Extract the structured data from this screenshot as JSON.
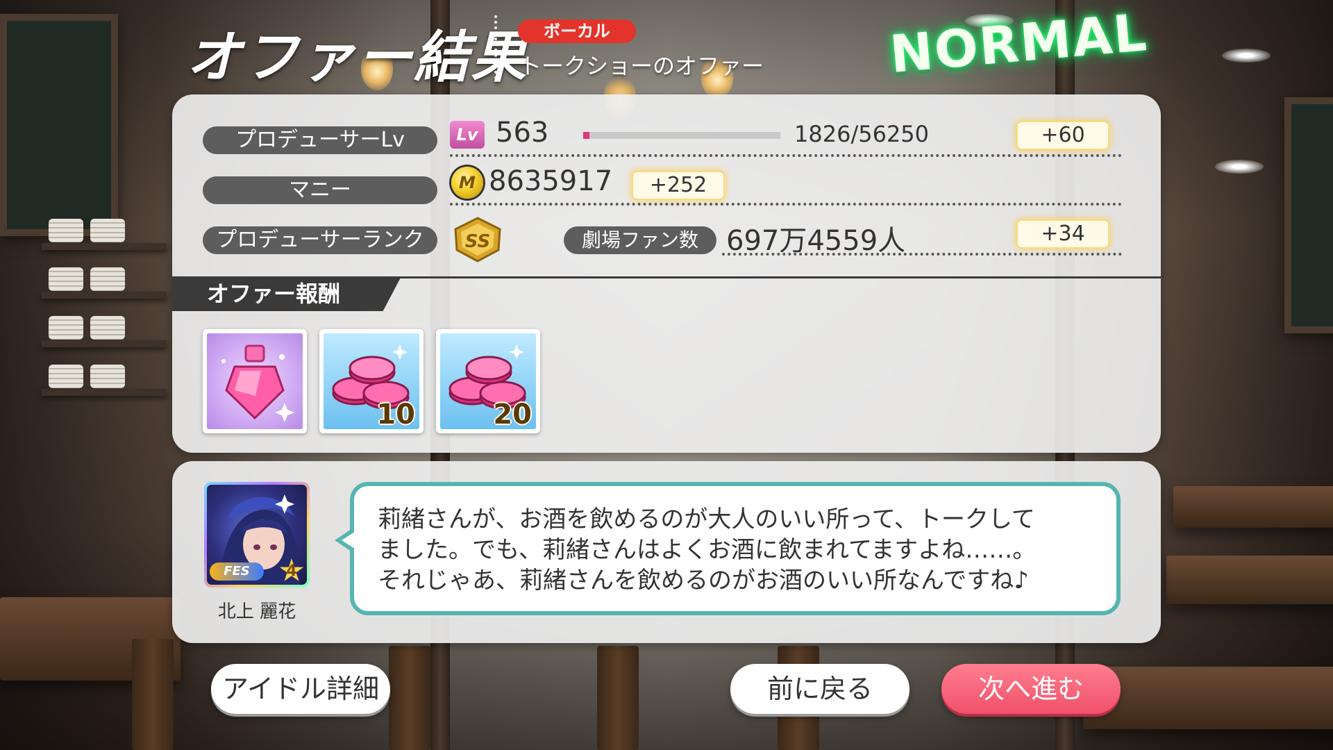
{
  "header": {
    "title": "オファー結果",
    "category": "ボーカル",
    "offer_name": "トークショーのオファー",
    "difficulty": "NORMAL"
  },
  "stats": {
    "producer_lv": {
      "label": "プロデューサーLv",
      "icon_text": "Lv",
      "value": "563",
      "exp_text": "1826/56250",
      "exp_progress": 0.0325,
      "gain": "+60"
    },
    "money": {
      "label": "マニー",
      "icon_text": "M",
      "value": "8635917",
      "gain": "+252"
    },
    "rank": {
      "label": "プロデューサーランク",
      "badge": "SS",
      "fan_label": "劇場ファン数",
      "fan_value": "697万4559人",
      "gain": "+34"
    }
  },
  "rewards": {
    "section_label": "オファー報酬",
    "items": [
      {
        "icon": "pink-potion-icon",
        "count": ""
      },
      {
        "icon": "pink-coins-icon",
        "count": "10"
      },
      {
        "icon": "pink-coins-icon",
        "count": "20"
      }
    ]
  },
  "idol": {
    "name": "北上 麗花",
    "card_tag": "FES",
    "card_rank": "4",
    "message_lines": [
      "莉緒さんが、お酒を飲めるのが大人のいい所って、トークして",
      "ました。でも、莉緒さんはよくお酒に飲まれてますよね……。",
      "それじゃあ、莉緒さんを飲めるのがお酒のいい所なんですね♪"
    ]
  },
  "buttons": {
    "idol_detail": "アイドル詳細",
    "back": "前に戻る",
    "next": "次へ進む"
  },
  "colors": {
    "category_badge": "#e3342b",
    "exp_bar": "#e3347c",
    "bubble_border": "#56b5b0",
    "next_button": "#f0516a",
    "difficulty_glow": "#22e06a"
  }
}
